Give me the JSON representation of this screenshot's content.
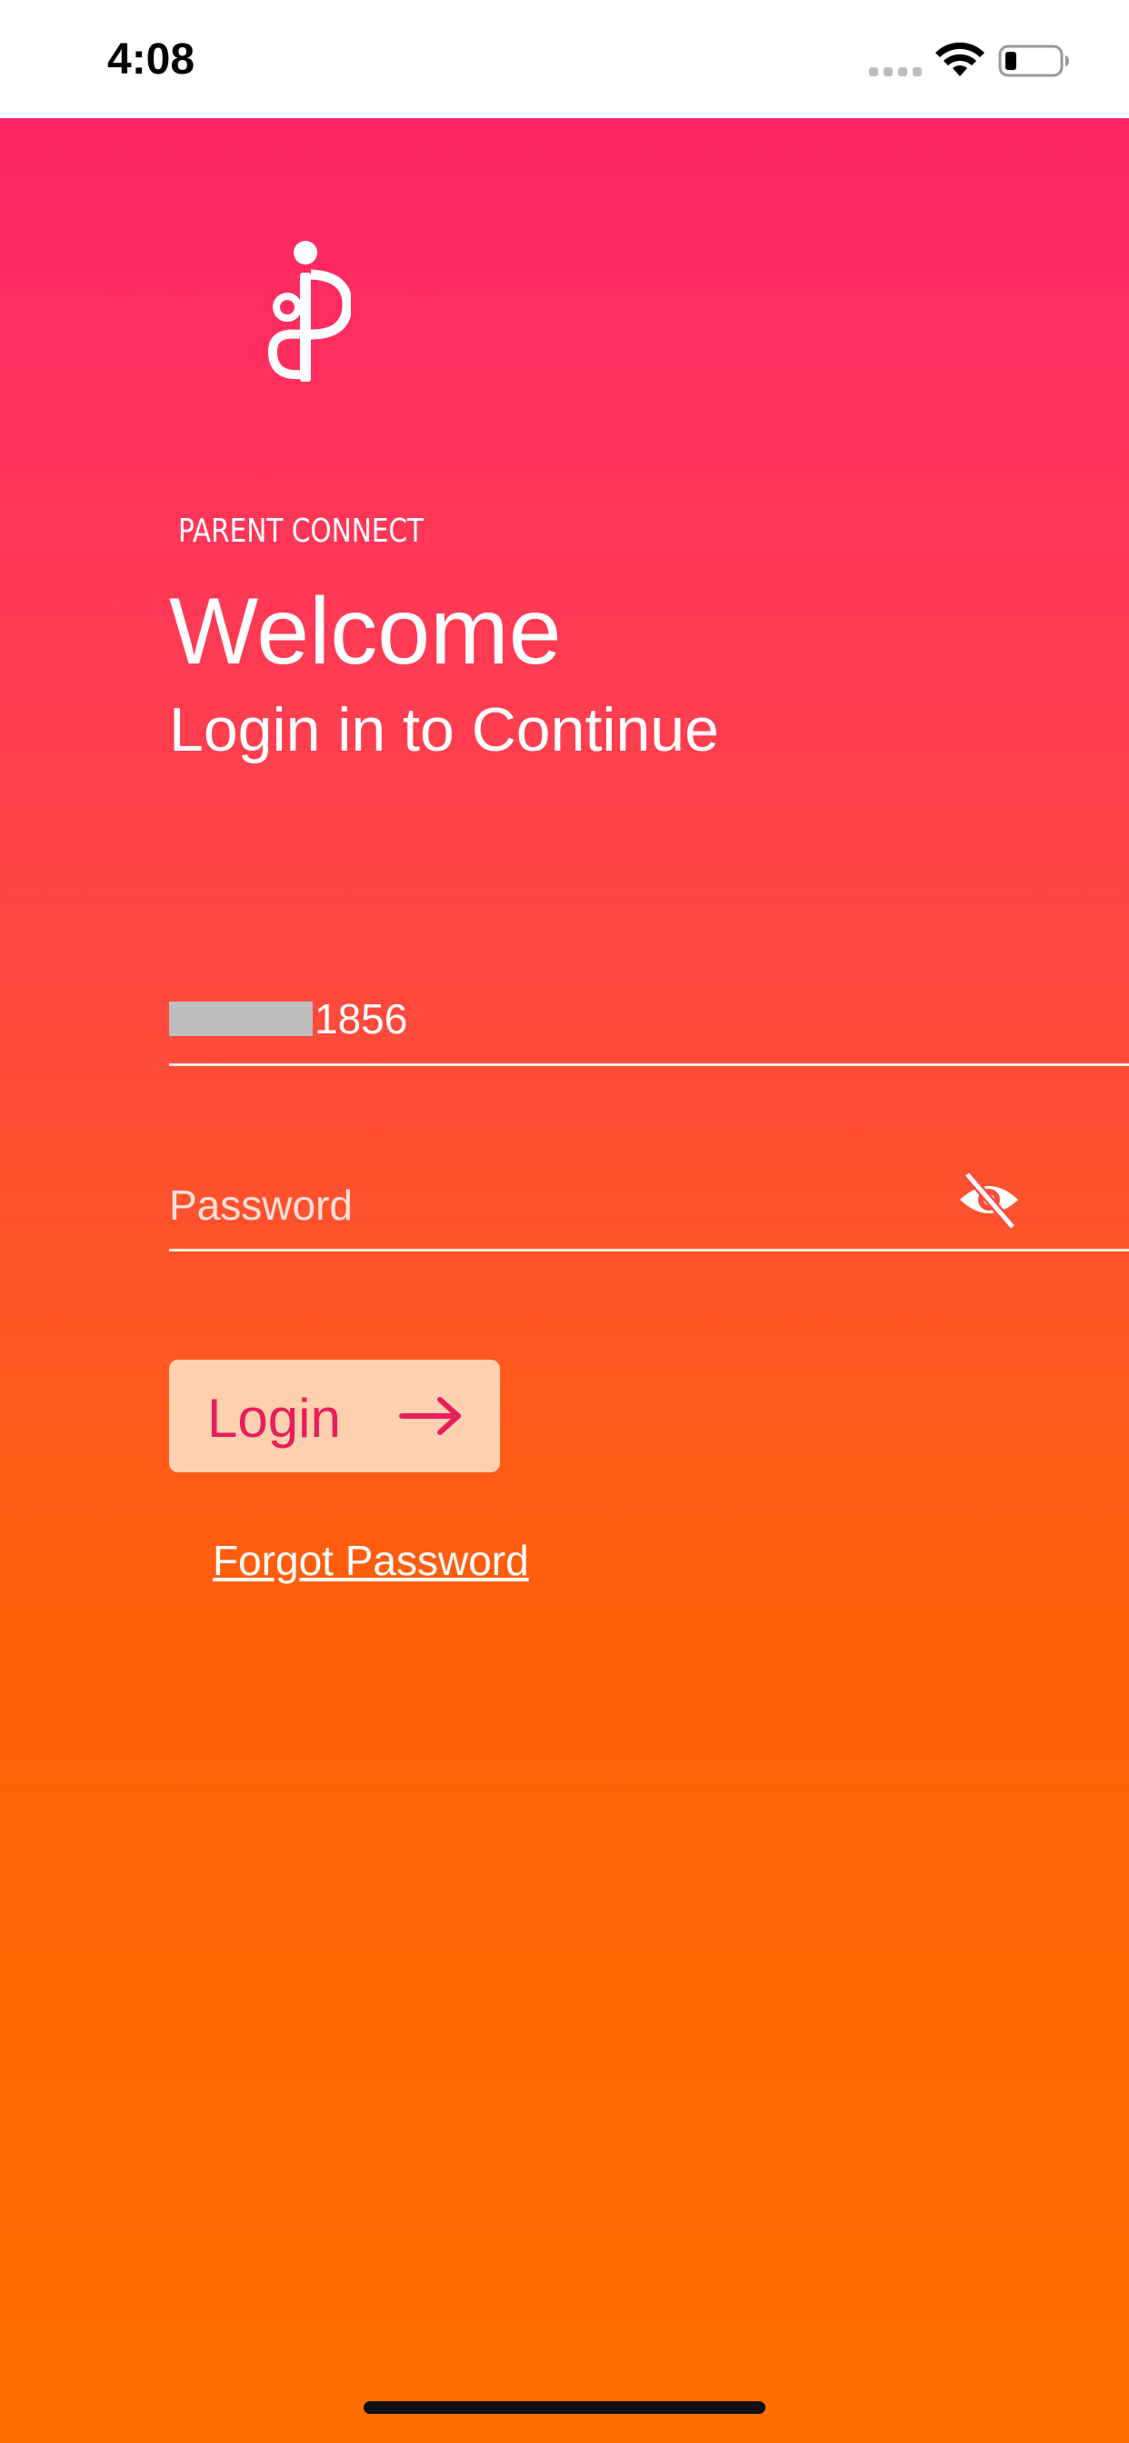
{
  "status_bar": {
    "time": "4:08",
    "icons": [
      "cellular-signal-icon",
      "wifi-icon",
      "battery-icon"
    ]
  },
  "logo": {
    "text": "PARENT CONNECT",
    "icon": "parent-connect-logo-icon"
  },
  "welcome": {
    "title": "Welcome",
    "subtitle": "Login in to Continue"
  },
  "form": {
    "phone_value_visible": "1856",
    "password_placeholder": "Password",
    "password_value": "",
    "visibility_icon": "eye-off-icon",
    "login_label": "Login",
    "login_icon": "arrow-right-icon",
    "forgot_password": "Forgot Password"
  },
  "colors": {
    "gradient_top": "#ff2467",
    "gradient_bottom": "#ff7101",
    "button_bg": "#ffd0b0",
    "button_text": "#e81f5a",
    "text": "#ffffff"
  }
}
